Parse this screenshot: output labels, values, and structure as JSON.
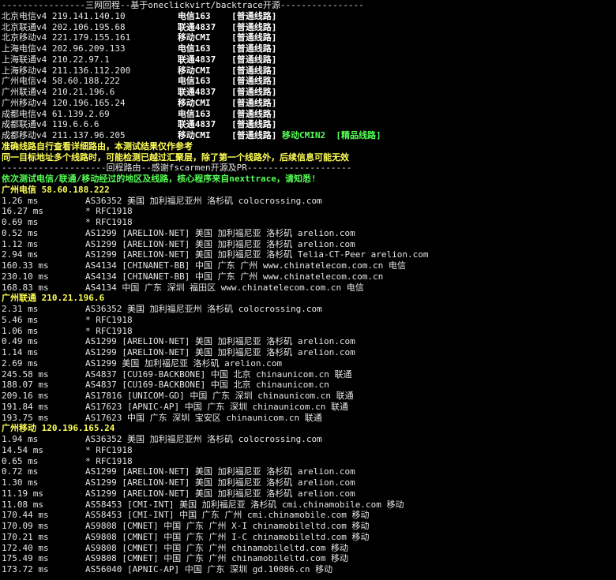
{
  "colors": {
    "background": "#000000",
    "text": "#e6e6e6",
    "yellow": "#ffff55",
    "green": "#55ff55"
  },
  "lines": [
    [
      {
        "t": "----------------三网回程--基于oneclickvirt/backtrace开源----------------",
        "c": "w"
      }
    ],
    [
      {
        "t": "北京电信v4 219.141.140.10          ",
        "c": "w"
      },
      {
        "t": "电信163    ",
        "c": "b"
      },
      {
        "t": "[普通线路]",
        "c": "b"
      }
    ],
    [
      {
        "t": "北京联通v4 202.106.195.68          ",
        "c": "w"
      },
      {
        "t": "联通4837   ",
        "c": "b"
      },
      {
        "t": "[普通线路]",
        "c": "b"
      }
    ],
    [
      {
        "t": "北京移动v4 221.179.155.161         ",
        "c": "w"
      },
      {
        "t": "移动CMI    ",
        "c": "b"
      },
      {
        "t": "[普通线路]",
        "c": "b"
      }
    ],
    [
      {
        "t": "上海电信v4 202.96.209.133          ",
        "c": "w"
      },
      {
        "t": "电信163    ",
        "c": "b"
      },
      {
        "t": "[普通线路]",
        "c": "b"
      }
    ],
    [
      {
        "t": "上海联通v4 210.22.97.1             ",
        "c": "w"
      },
      {
        "t": "联通4837   ",
        "c": "b"
      },
      {
        "t": "[普通线路]",
        "c": "b"
      }
    ],
    [
      {
        "t": "上海移动v4 211.136.112.200         ",
        "c": "w"
      },
      {
        "t": "移动CMI    ",
        "c": "b"
      },
      {
        "t": "[普通线路]",
        "c": "b"
      }
    ],
    [
      {
        "t": "广州电信v4 58.60.188.222           ",
        "c": "w"
      },
      {
        "t": "电信163    ",
        "c": "b"
      },
      {
        "t": "[普通线路]",
        "c": "b"
      }
    ],
    [
      {
        "t": "广州联通v4 210.21.196.6            ",
        "c": "w"
      },
      {
        "t": "联通4837   ",
        "c": "b"
      },
      {
        "t": "[普通线路]",
        "c": "b"
      }
    ],
    [
      {
        "t": "广州移动v4 120.196.165.24          ",
        "c": "w"
      },
      {
        "t": "移动CMI    ",
        "c": "b"
      },
      {
        "t": "[普通线路]",
        "c": "b"
      }
    ],
    [
      {
        "t": "成都电信v4 61.139.2.69             ",
        "c": "w"
      },
      {
        "t": "电信163    ",
        "c": "b"
      },
      {
        "t": "[普通线路]",
        "c": "b"
      }
    ],
    [
      {
        "t": "成都联通v4 119.6.6.6               ",
        "c": "w"
      },
      {
        "t": "联通4837   ",
        "c": "b"
      },
      {
        "t": "[普通线路]",
        "c": "b"
      }
    ],
    [
      {
        "t": "成都移动v4 211.137.96.205          ",
        "c": "w"
      },
      {
        "t": "移动CMI    ",
        "c": "b"
      },
      {
        "t": "[普通线路] ",
        "c": "b"
      },
      {
        "t": "移动CMIN2  [精品线路]",
        "c": "g"
      }
    ],
    [
      {
        "t": "准确线路自行查看详细路由，本测试结果仅作参考",
        "c": "y"
      }
    ],
    [
      {
        "t": "同一目标地址多个线路时，可能检测已越过汇聚层，除了第一个线路外，后续信息可能无效",
        "c": "y"
      }
    ],
    [
      {
        "t": "--------------------回程路由--感谢fscarmen开源及PR--------------------",
        "c": "w"
      }
    ],
    [
      {
        "t": "依次测试电信/联通/移动经过的地区及线路，核心程序来自nexttrace，请知悉!",
        "c": "g"
      }
    ],
    [
      {
        "t": "广州电信 58.60.188.222",
        "c": "y"
      }
    ],
    [
      {
        "t": "1.26 ms         AS36352 美国 加利福尼亚州 洛杉矶 colocrossing.com",
        "c": "w"
      }
    ],
    [
      {
        "t": "16.27 ms        * RFC1918",
        "c": "w"
      }
    ],
    [
      {
        "t": "0.69 ms         * RFC1918",
        "c": "w"
      }
    ],
    [
      {
        "t": "0.52 ms         AS1299 [ARELION-NET] 美国 加利福尼亚 洛杉矶 arelion.com",
        "c": "w"
      }
    ],
    [
      {
        "t": "1.12 ms         AS1299 [ARELION-NET] 美国 加利福尼亚 洛杉矶 arelion.com",
        "c": "w"
      }
    ],
    [
      {
        "t": "2.94 ms         AS1299 [ARELION-NET] 美国 加利福尼亚 洛杉矶 Telia-CT-Peer arelion.com",
        "c": "w"
      }
    ],
    [
      {
        "t": "160.33 ms       AS4134 [CHINANET-BB] 中国 广东 广州 www.chinatelecom.com.cn 电信",
        "c": "w"
      }
    ],
    [
      {
        "t": "230.10 ms       AS4134 [CHINANET-BB] 中国 广东 广州 www.chinatelecom.com.cn",
        "c": "w"
      }
    ],
    [
      {
        "t": "168.83 ms       AS4134 中国 广东 深圳 福田区 www.chinatelecom.com.cn 电信",
        "c": "w"
      }
    ],
    [
      {
        "t": "广州联通 210.21.196.6",
        "c": "y"
      }
    ],
    [
      {
        "t": "2.31 ms         AS36352 美国 加利福尼亚州 洛杉矶 colocrossing.com",
        "c": "w"
      }
    ],
    [
      {
        "t": "5.46 ms         * RFC1918",
        "c": "w"
      }
    ],
    [
      {
        "t": "1.06 ms         * RFC1918",
        "c": "w"
      }
    ],
    [
      {
        "t": "0.49 ms         AS1299 [ARELION-NET] 美国 加利福尼亚 洛杉矶 arelion.com",
        "c": "w"
      }
    ],
    [
      {
        "t": "1.14 ms         AS1299 [ARELION-NET] 美国 加利福尼亚 洛杉矶 arelion.com",
        "c": "w"
      }
    ],
    [
      {
        "t": "2.69 ms         AS1299 美国 加利福尼亚 洛杉矶 arelion.com",
        "c": "w"
      }
    ],
    [
      {
        "t": "245.58 ms       AS4837 [CU169-BACKBONE] 中国 北京 chinaunicom.cn 联通",
        "c": "w"
      }
    ],
    [
      {
        "t": "188.07 ms       AS4837 [CU169-BACKBONE] 中国 北京 chinaunicom.cn",
        "c": "w"
      }
    ],
    [
      {
        "t": "209.16 ms       AS17816 [UNICOM-GD] 中国 广东 深圳 chinaunicom.cn 联通",
        "c": "w"
      }
    ],
    [
      {
        "t": "191.84 ms       AS17623 [APNIC-AP] 中国 广东 深圳 chinaunicom.cn 联通",
        "c": "w"
      }
    ],
    [
      {
        "t": "193.75 ms       AS17623 中国 广东 深圳 宝安区 chinaunicom.cn 联通",
        "c": "w"
      }
    ],
    [
      {
        "t": "广州移动 120.196.165.24",
        "c": "y"
      }
    ],
    [
      {
        "t": "1.94 ms         AS36352 美国 加利福尼亚州 洛杉矶 colocrossing.com",
        "c": "w"
      }
    ],
    [
      {
        "t": "14.54 ms        * RFC1918",
        "c": "w"
      }
    ],
    [
      {
        "t": "0.65 ms         * RFC1918",
        "c": "w"
      }
    ],
    [
      {
        "t": "0.72 ms         AS1299 [ARELION-NET] 美国 加利福尼亚 洛杉矶 arelion.com",
        "c": "w"
      }
    ],
    [
      {
        "t": "1.30 ms         AS1299 [ARELION-NET] 美国 加利福尼亚 洛杉矶 arelion.com",
        "c": "w"
      }
    ],
    [
      {
        "t": "11.19 ms        AS1299 [ARELION-NET] 美国 加利福尼亚 洛杉矶 arelion.com",
        "c": "w"
      }
    ],
    [
      {
        "t": "11.08 ms        AS58453 [CMI-INT] 美国 加利福尼亚 洛杉矶 cmi.chinamobile.com 移动",
        "c": "w"
      }
    ],
    [
      {
        "t": "170.44 ms       AS58453 [CMI-INT] 中国 广东 广州 cmi.chinamobile.com 移动",
        "c": "w"
      }
    ],
    [
      {
        "t": "170.09 ms       AS9808 [CMNET] 中国 广东 广州 X-I chinamobileltd.com 移动",
        "c": "w"
      }
    ],
    [
      {
        "t": "170.21 ms       AS9808 [CMNET] 中国 广东 广州 I-C chinamobileltd.com 移动",
        "c": "w"
      }
    ],
    [
      {
        "t": "172.40 ms       AS9808 [CMNET] 中国 广东 广州 chinamobileltd.com 移动",
        "c": "w"
      }
    ],
    [
      {
        "t": "175.49 ms       AS9808 [CMNET] 中国 广东 广州 chinamobileltd.com 移动",
        "c": "w"
      }
    ],
    [
      {
        "t": "173.72 ms       AS56040 [APNIC-AP] 中国 广东 深圳 gd.10086.cn 移动",
        "c": "w"
      }
    ]
  ]
}
